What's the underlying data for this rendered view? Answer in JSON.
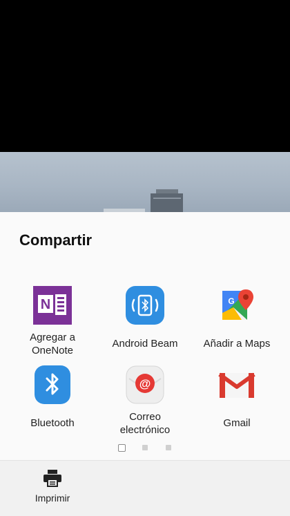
{
  "share_sheet": {
    "title": "Compartir",
    "targets": [
      {
        "line1": "Agregar a",
        "line2": "OneNote",
        "icon": "onenote-icon"
      },
      {
        "line1": "Android Beam",
        "line2": "",
        "icon": "android-beam-icon"
      },
      {
        "line1": "Añadir a Maps",
        "line2": "",
        "icon": "google-maps-icon"
      },
      {
        "line1": "Bluetooth",
        "line2": "",
        "icon": "bluetooth-icon"
      },
      {
        "line1": "Correo",
        "line2": "electrónico",
        "icon": "email-icon"
      },
      {
        "line1": "Gmail",
        "line2": "",
        "icon": "gmail-icon"
      }
    ],
    "pages": {
      "total": 3,
      "current": 1
    }
  },
  "bottom_bar": {
    "print_label": "Imprimir",
    "icon": "printer-icon"
  },
  "colors": {
    "onenote": "#7b3197",
    "samsung_blue": "#2f8ee0",
    "gmail_red": "#d93a2f",
    "sheet_bg": "#fafafa"
  }
}
